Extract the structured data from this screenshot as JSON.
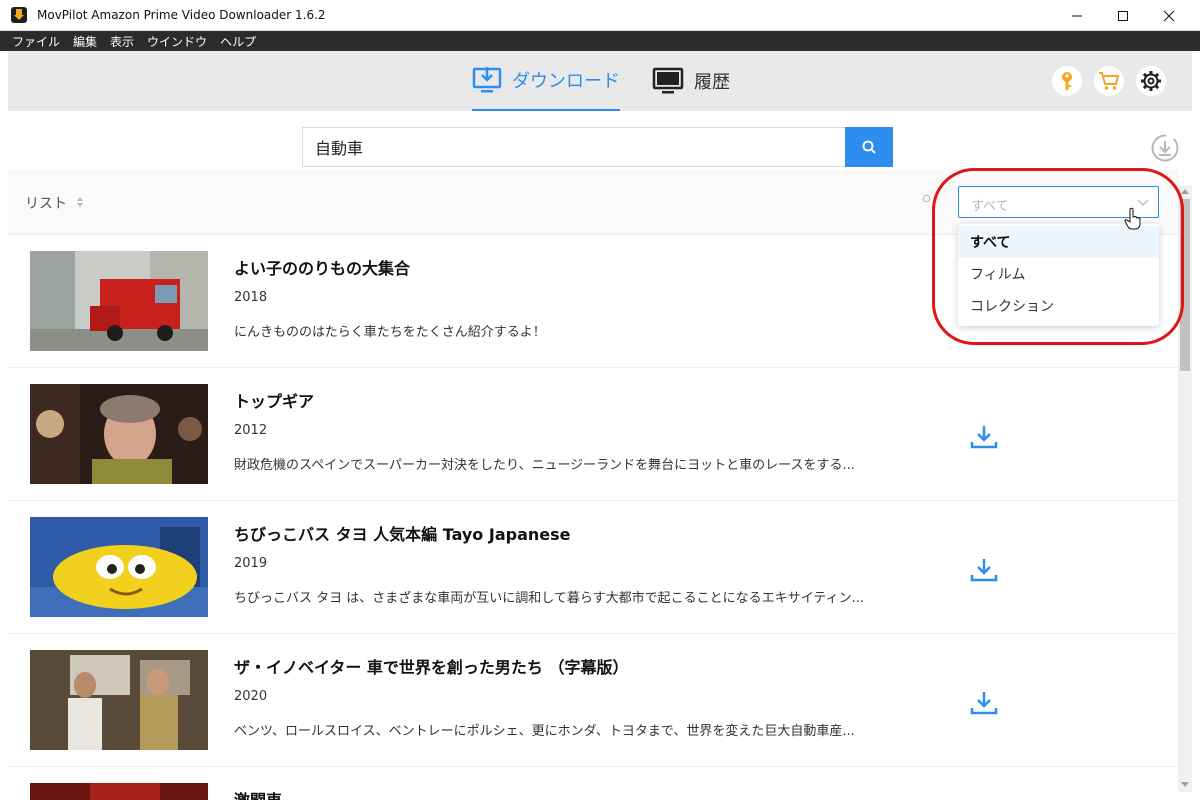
{
  "window": {
    "title": "MovPilot Amazon Prime Video Downloader 1.6.2",
    "minimize": "—",
    "maximize": "☐",
    "close": "✕"
  },
  "menu": [
    "ファイル",
    "編集",
    "表示",
    "ウインドウ",
    "ヘルプ"
  ],
  "tabs": {
    "download": "ダウンロード",
    "history": "履歴"
  },
  "search": {
    "value": "自動車"
  },
  "list": {
    "label": "リスト"
  },
  "filter": {
    "selected": "すべて",
    "options": [
      "すべて",
      "フィルム",
      "コレクション"
    ]
  },
  "colors": {
    "accent": "#2d8ef0",
    "highlight": "#e01515",
    "key_icon": "#f5a623"
  },
  "rows": [
    {
      "title": "よい子ののりもの大集合",
      "year": "2018",
      "desc": "にんきもののはたらく車たちをたくさん紹介するよ！"
    },
    {
      "title": "トップギア",
      "year": "2012",
      "desc": "財政危機のスペインでスーパーカー対決をしたり、ニュージーランドを舞台にヨットと車のレースをする..."
    },
    {
      "title": "ちびっこバス タヨ 人気本編 Tayo Japanese",
      "year": "2019",
      "desc": "ちびっこバス タヨ は、さまざまな車両が互いに調和して暮らす大都市で起こることになるエキサイティン..."
    },
    {
      "title": "ザ・イノベイター 車で世界を創った男たち （字幕版）",
      "year": "2020",
      "desc": "ベンツ、ロールスロイス、ベントレーにポルシェ、更にホンダ、トヨタまで、世界を変えた巨大自動車産..."
    },
    {
      "title": "激闘車",
      "year": "",
      "desc": ""
    }
  ]
}
